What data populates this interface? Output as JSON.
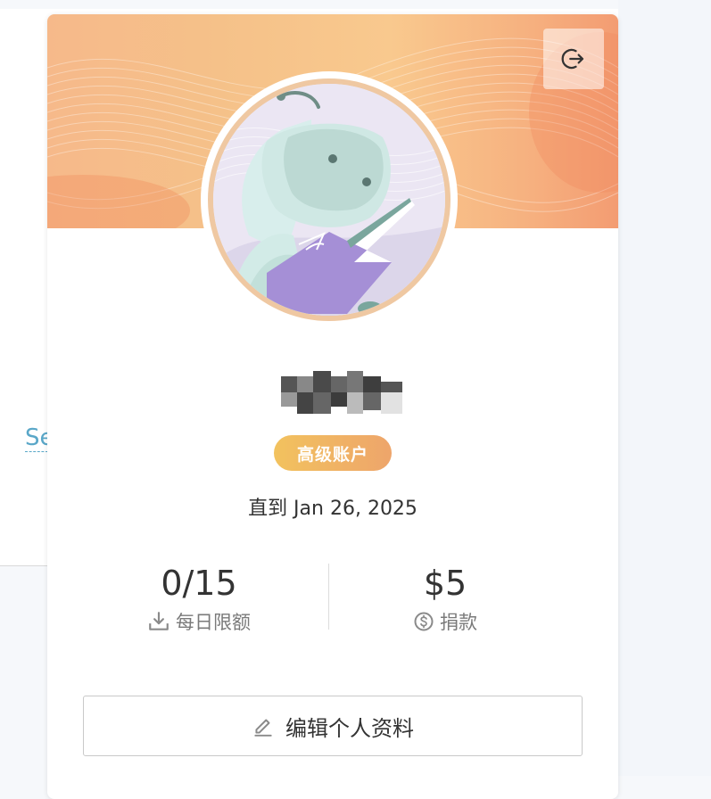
{
  "background": {
    "link_text": "Se"
  },
  "profile": {
    "logout_icon": "logout-icon",
    "avatar_icon": "robot-reading-book-avatar",
    "username": "",
    "badge": "高级账户",
    "valid_until": "直到 Jan 26, 2025",
    "stats": {
      "quota": {
        "value": "0/15",
        "label": "每日限额",
        "icon": "download-icon"
      },
      "donation": {
        "value": "$5",
        "label": "捐款",
        "icon": "dollar-circle-icon"
      }
    },
    "edit_button": {
      "label": "编辑个人资料",
      "icon": "pencil-icon"
    }
  },
  "colors": {
    "banner_start": "#f6b98a",
    "banner_end": "#f39c72",
    "badge_start": "#f2c25e",
    "badge_end": "#eea56b",
    "avatar_border": "#efc8a2"
  }
}
